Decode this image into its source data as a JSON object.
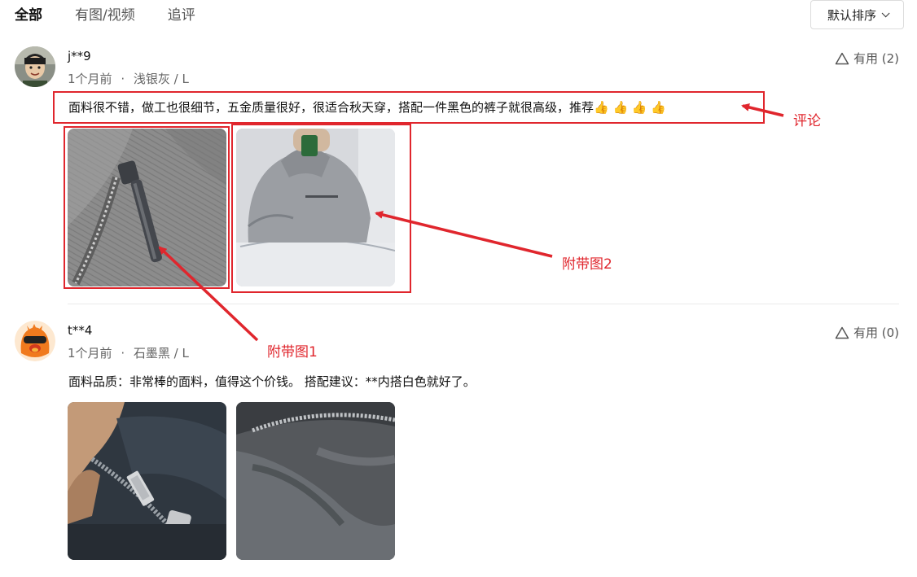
{
  "tabs": [
    {
      "label": "全部",
      "active": true
    },
    {
      "label": "有图/视频",
      "active": false
    },
    {
      "label": "追评",
      "active": false
    }
  ],
  "sort": {
    "label": "默认排序",
    "icon": "chevron-down-icon"
  },
  "reviews": [
    {
      "username": "j**9",
      "time": "1个月前",
      "separator": "·",
      "variant": "浅银灰 / L",
      "useful_label": "有用 (2)",
      "comment": "面料很不错，做工也很细节，五金质量很好，很适合秋天穿，搭配一件黑色的裤子就很高级，推荐👍 👍 👍 👍",
      "photos": [
        "zipper-closeup-photo",
        "mirror-selfie-photo"
      ]
    },
    {
      "username": "t**4",
      "time": "1个月前",
      "separator": "·",
      "variant": "石墨黑 / L",
      "useful_label": "有用 (0)",
      "comment": "面料品质：非常棒的面料，值得这个价钱。 搭配建议：**内搭白色就好了。",
      "photos": [
        "dark-zipper-photo",
        "dark-fabric-photo"
      ]
    }
  ],
  "annotations": {
    "comment_label": "评论",
    "photo1_label": "附带图1",
    "photo2_label": "附带图2",
    "color": "#e0262d"
  }
}
